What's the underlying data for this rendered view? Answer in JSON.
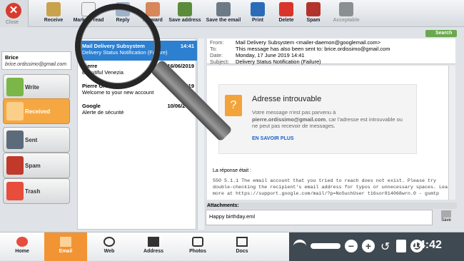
{
  "toolbar": {
    "close": "Close",
    "buttons": [
      {
        "label": "Receive"
      },
      {
        "label": "Mark all read"
      },
      {
        "label": "Reply"
      },
      {
        "label": "Forward"
      },
      {
        "label": "Save address"
      },
      {
        "label": "Save the email"
      },
      {
        "label": "Print"
      },
      {
        "label": "Delete"
      },
      {
        "label": "Spam"
      },
      {
        "label": "Acceptable"
      }
    ],
    "search": "Search"
  },
  "account": {
    "name": "Brice",
    "email": "brice.ordissimo@gmail.com"
  },
  "folders": [
    {
      "label": "Write",
      "color": "#7ab648"
    },
    {
      "label": "Received",
      "color": "#f39b2f"
    },
    {
      "label": "Sent",
      "color": "#5b6b7a"
    },
    {
      "label": "Spam",
      "color": "#c0392b"
    },
    {
      "label": "Trash",
      "color": "#e74c3c"
    }
  ],
  "messages": [
    {
      "sender": "Mail Delivery Subsystem",
      "date": "14:41",
      "subject": "Delivery Status Notification (Failure)"
    },
    {
      "sender": "Pierre",
      "date": "16/06/2019",
      "subject": "Beautiful Venezia"
    },
    {
      "sender": "Pierre Ordissimo",
      "date": "13/06/2019",
      "subject": "Welcome to your new account"
    },
    {
      "sender": "Google",
      "date": "10/06/2019",
      "subject": "Alerte de sécurité"
    }
  ],
  "header": {
    "from_key": "From:",
    "from": "Mail Delivery Subsystem <mailer-daemon@googlemail.com>",
    "to_key": "To:",
    "to": "This message has also been sent to: brice.ordissimo@gmail.com",
    "date_key": "Date:",
    "date": "Monday, 17 June 2019 14:41",
    "subject_key": "Subject:",
    "subject": "Delivery Status Notification (Failure)"
  },
  "body": {
    "title": "Adresse introuvable",
    "text1": "Votre message n'est pas parvenu à",
    "email": "pierre.ordissimo@gmail.com",
    "text2": ", car l'adresse est introuvable ou ne peut pas recevoir de messages.",
    "link": "EN SAVOIR PLUS",
    "reply_label": "La réponse était :",
    "reply_line1": "550 5.1.1 The email account that you tried to reach does not exist. Please try",
    "reply_line2": "double-checking the recipient's email address for typos or unnecessary spaces. Learn",
    "reply_line3": "more at https://support.google.com/mail/?p=NoSuchUser t16sor814068wrn.0 - gsmtp"
  },
  "attachments": {
    "label": "Attachments:",
    "file": "Happy birthday.eml",
    "save": "Save"
  },
  "taskbar": {
    "items": [
      {
        "label": "Home"
      },
      {
        "label": "Email"
      },
      {
        "label": "Web"
      },
      {
        "label": "Address"
      },
      {
        "label": "Photos"
      },
      {
        "label": "Docs"
      }
    ],
    "time": "14:42"
  }
}
